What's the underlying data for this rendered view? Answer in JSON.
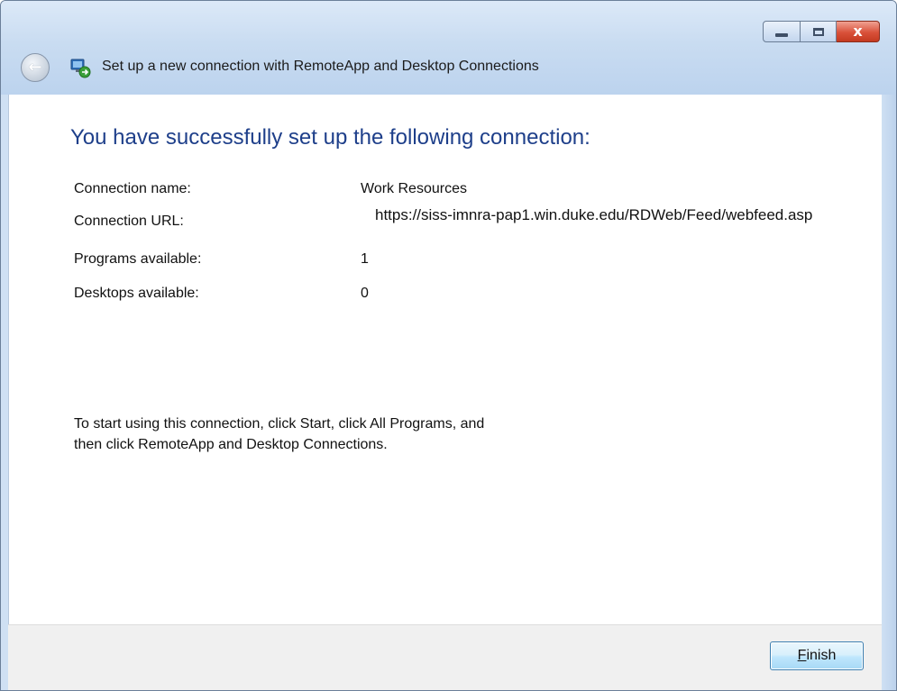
{
  "window": {
    "title": "Set up a new connection with RemoteApp and Desktop Connections",
    "controls": {
      "minimize_icon": "minimize-icon",
      "maximize_icon": "maximize-icon",
      "close_icon": "close-icon",
      "close_glyph": "x"
    },
    "back_icon": "back-arrow-icon",
    "app_icon": "remoteapp-connection-icon"
  },
  "main": {
    "heading": "You have successfully set up the following connection:",
    "details": {
      "connection_name_label": "Connection name:",
      "connection_name_value": "Work Resources",
      "connection_url_label": "Connection URL:",
      "connection_url_value": "https://siss-imnra-pap1.win.duke.edu/RDWeb/Feed/webfeed.asp",
      "programs_label": "Programs available:",
      "programs_value": "1",
      "desktops_label": "Desktops available:",
      "desktops_value": "0"
    },
    "instructions": "To start using this connection, click Start, click All Programs, and then click RemoteApp and Desktop Connections."
  },
  "footer": {
    "finish_mnemonic": "F",
    "finish_rest": "inish"
  },
  "colors": {
    "heading": "#1e3f8a",
    "titlebar": "#c9dcf1",
    "close_button": "#d9513a",
    "footer": "#f0f0f0"
  }
}
